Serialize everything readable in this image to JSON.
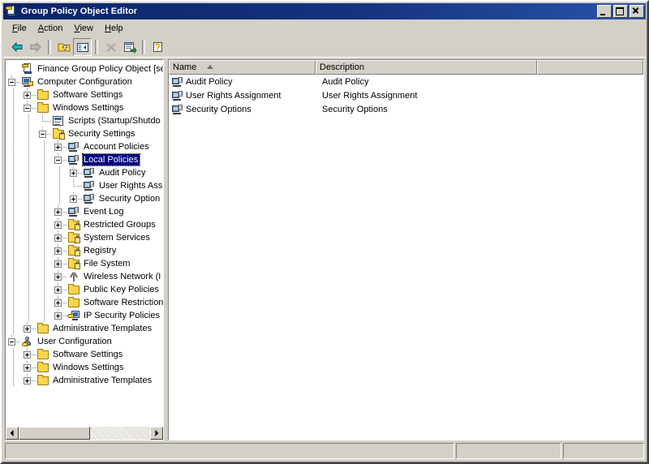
{
  "window": {
    "title": "Group Policy Object Editor",
    "title_icon": "gpo-console-icon",
    "minimize_label": "Minimize",
    "maximize_label": "Maximize",
    "close_label": "Close"
  },
  "menubar": {
    "items": [
      {
        "label": "File",
        "accel": "F"
      },
      {
        "label": "Action",
        "accel": "A"
      },
      {
        "label": "View",
        "accel": "V"
      },
      {
        "label": "Help",
        "accel": "H"
      }
    ]
  },
  "toolbar": {
    "buttons": [
      {
        "name": "back-button",
        "icon": "arrow-left-icon",
        "enabled": true
      },
      {
        "name": "forward-button",
        "icon": "arrow-right-icon",
        "enabled": false
      },
      {
        "name": "up-one-level-button",
        "icon": "folder-up-icon",
        "enabled": true
      },
      {
        "name": "show-hide-console-tree-button",
        "icon": "tree-pane-icon",
        "enabled": true,
        "pressed": true
      },
      {
        "name": "delete-button",
        "icon": "delete-x-icon",
        "enabled": false
      },
      {
        "name": "export-list-button",
        "icon": "export-list-icon",
        "enabled": true
      },
      {
        "name": "help-button",
        "icon": "help-question-icon",
        "enabled": true
      }
    ]
  },
  "tree": {
    "nodes": [
      {
        "label": "Finance Group Policy Object [server",
        "icon": "gpo-icon",
        "depth": 0,
        "expander": "none",
        "selected": false
      },
      {
        "label": "Computer Configuration",
        "icon": "computer-icon",
        "depth": 0,
        "expander": "minus",
        "selected": false
      },
      {
        "label": "Software Settings",
        "icon": "folder-icon",
        "depth": 1,
        "expander": "plus",
        "selected": false
      },
      {
        "label": "Windows Settings",
        "icon": "folder-icon",
        "depth": 1,
        "expander": "minus",
        "selected": false
      },
      {
        "label": "Scripts (Startup/Shutdo",
        "icon": "scripts-icon",
        "depth": 2,
        "expander": "none",
        "selected": false
      },
      {
        "label": "Security Settings",
        "icon": "folder-lock-icon",
        "depth": 2,
        "expander": "minus",
        "selected": false
      },
      {
        "label": "Account Policies",
        "icon": "policy-icon",
        "depth": 3,
        "expander": "plus",
        "selected": false
      },
      {
        "label": "Local Policies",
        "icon": "policy-icon",
        "depth": 3,
        "expander": "minus",
        "selected": true
      },
      {
        "label": "Audit Policy",
        "icon": "policy-icon",
        "depth": 4,
        "expander": "plus",
        "selected": false
      },
      {
        "label": "User Rights Ass",
        "icon": "policy-icon",
        "depth": 4,
        "expander": "none",
        "selected": false
      },
      {
        "label": "Security Option",
        "icon": "policy-icon",
        "depth": 4,
        "expander": "plus",
        "selected": false
      },
      {
        "label": "Event Log",
        "icon": "policy-icon",
        "depth": 3,
        "expander": "plus",
        "selected": false
      },
      {
        "label": "Restricted Groups",
        "icon": "folder-lock-icon",
        "depth": 3,
        "expander": "plus",
        "selected": false
      },
      {
        "label": "System Services",
        "icon": "folder-lock-icon",
        "depth": 3,
        "expander": "plus",
        "selected": false
      },
      {
        "label": "Registry",
        "icon": "folder-lock-icon",
        "depth": 3,
        "expander": "plus",
        "selected": false
      },
      {
        "label": "File System",
        "icon": "folder-lock-icon",
        "depth": 3,
        "expander": "plus",
        "selected": false
      },
      {
        "label": "Wireless Network (I",
        "icon": "wireless-icon",
        "depth": 3,
        "expander": "plus",
        "selected": false
      },
      {
        "label": "Public Key Policies",
        "icon": "folder-icon",
        "depth": 3,
        "expander": "plus",
        "selected": false
      },
      {
        "label": "Software Restriction",
        "icon": "folder-icon",
        "depth": 3,
        "expander": "plus",
        "selected": false
      },
      {
        "label": "IP Security Policies ",
        "icon": "ipsec-icon",
        "depth": 3,
        "expander": "plus",
        "selected": false
      },
      {
        "label": "Administrative Templates",
        "icon": "folder-icon",
        "depth": 1,
        "expander": "plus",
        "selected": false
      },
      {
        "label": "User Configuration",
        "icon": "user-icon",
        "depth": 0,
        "expander": "minus",
        "selected": false
      },
      {
        "label": "Software Settings",
        "icon": "folder-icon",
        "depth": 1,
        "expander": "plus",
        "selected": false
      },
      {
        "label": "Windows Settings",
        "icon": "folder-icon",
        "depth": 1,
        "expander": "plus",
        "selected": false
      },
      {
        "label": "Administrative Templates",
        "icon": "folder-icon",
        "depth": 1,
        "expander": "plus",
        "selected": false
      }
    ],
    "hscrollbar": {
      "left_arrow": "scroll-left-icon",
      "right_arrow": "scroll-right-icon"
    }
  },
  "list": {
    "columns": [
      {
        "label": "Name",
        "sort": "ascending"
      },
      {
        "label": "Description",
        "sort": "none"
      },
      {
        "label": "",
        "sort": "none"
      }
    ],
    "rows": [
      {
        "icon": "policy-icon",
        "name": "Audit Policy",
        "description": "Audit Policy"
      },
      {
        "icon": "policy-icon",
        "name": "User Rights Assignment",
        "description": "User Rights Assignment"
      },
      {
        "icon": "policy-icon",
        "name": "Security Options",
        "description": "Security Options"
      }
    ]
  },
  "statusbar": {
    "main": "",
    "pane2": "",
    "pane3": ""
  },
  "colors": {
    "title_active": "#0a246a",
    "selection": "#000080",
    "face": "#d4d0c8",
    "folder": "#ffd54a"
  }
}
